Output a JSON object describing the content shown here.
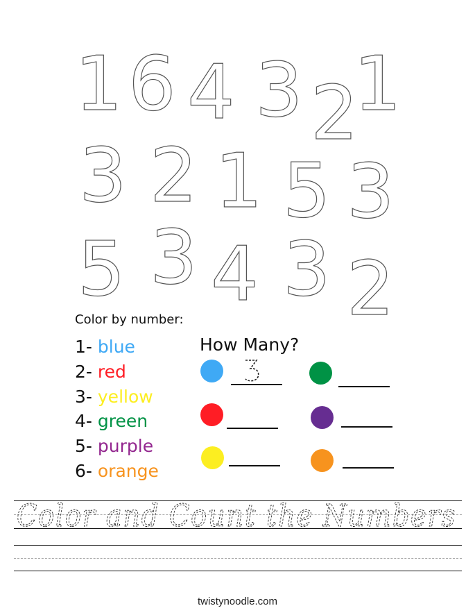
{
  "worksheet": {
    "title": "Color and Count the Numbers",
    "footer": "twistynoodle.com"
  },
  "digit_rows": [
    [
      "1",
      "6",
      "4",
      "3",
      "2",
      "1"
    ],
    [
      "3",
      "2",
      "1",
      "5",
      "3"
    ],
    [
      "5",
      "3",
      "4",
      "3",
      "2"
    ]
  ],
  "legend": {
    "title": "Color by number:",
    "items": [
      {
        "number": "1-",
        "color_name": "blue",
        "color": "#3fa9f5"
      },
      {
        "number": "2-",
        "color_name": "red",
        "color": "#ff1d25"
      },
      {
        "number": "3-",
        "color_name": "yellow",
        "color": "#fcee21"
      },
      {
        "number": "4-",
        "color_name": "green",
        "color": "#009245"
      },
      {
        "number": "5-",
        "color_name": "purple",
        "color": "#93278f"
      },
      {
        "number": "6-",
        "color_name": "orange",
        "color": "#f7931e"
      }
    ]
  },
  "how_many": {
    "title": "How Many?",
    "items": [
      {
        "color_name": "blue",
        "color": "#3fa9f5",
        "answer": "3"
      },
      {
        "color_name": "red",
        "color": "#ff1d25",
        "answer": ""
      },
      {
        "color_name": "yellow",
        "color": "#fcee21",
        "answer": ""
      },
      {
        "color_name": "green",
        "color": "#009245",
        "answer": ""
      },
      {
        "color_name": "purple",
        "color": "#662d91",
        "answer": ""
      },
      {
        "color_name": "orange",
        "color": "#f7931e",
        "answer": ""
      }
    ]
  }
}
